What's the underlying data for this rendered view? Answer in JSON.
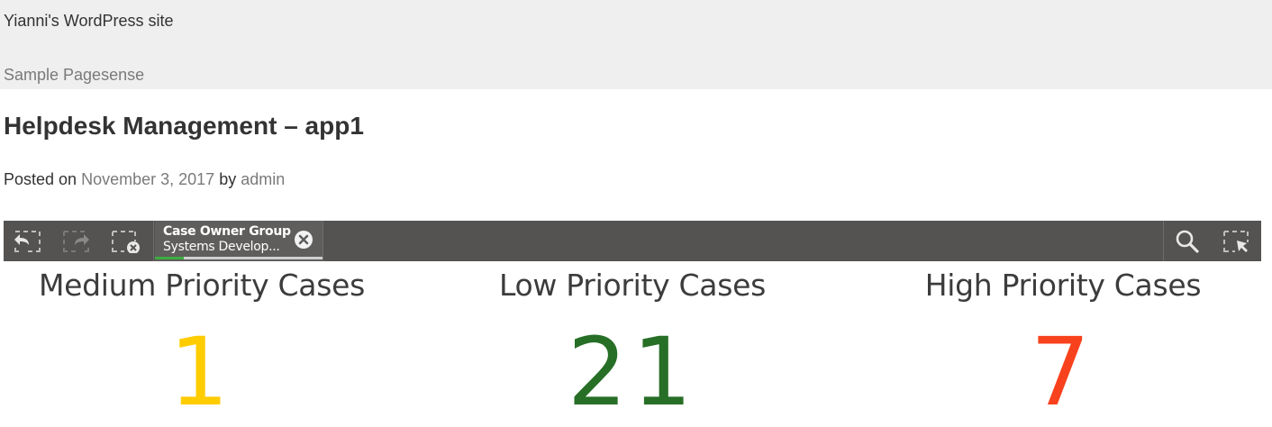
{
  "site": {
    "title": "Yianni's WordPress site",
    "description": "Sample Pagesense"
  },
  "post": {
    "title": "Helpdesk Management – app1",
    "posted_on_label": "Posted on",
    "date": "November 3, 2017",
    "by_label": "by",
    "author": "admin"
  },
  "toolbar": {
    "icons": {
      "back": "step-back-icon",
      "forward": "step-forward-icon",
      "clear": "clear-selections-icon",
      "search": "search-icon",
      "selection_mode": "selection-mode-icon"
    },
    "selection": {
      "field": "Case Owner Group",
      "value": "Systems Develop...",
      "selected_fraction": 0.17
    },
    "colors": {
      "background": "#545352",
      "selection_green": "#3cad40"
    }
  },
  "kpis": [
    {
      "title": "Medium Priority Cases",
      "value": "1",
      "color": "#ffcc00"
    },
    {
      "title": "Low Priority Cases",
      "value": "21",
      "color": "#276e27"
    },
    {
      "title": "High Priority Cases",
      "value": "7",
      "color": "#f8421d"
    }
  ]
}
